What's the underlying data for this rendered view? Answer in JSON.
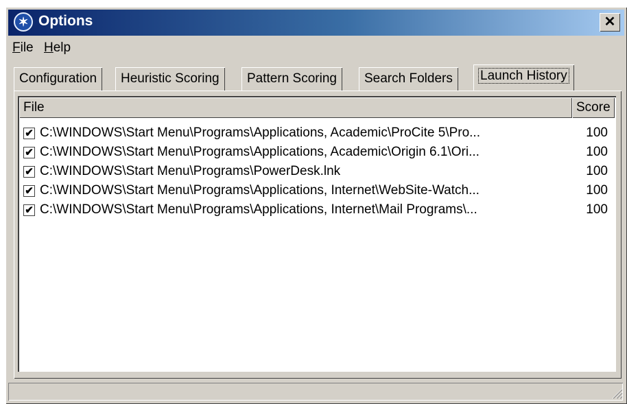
{
  "window": {
    "title": "Options",
    "close_glyph": "✕"
  },
  "menu": [
    {
      "label": "File",
      "accel": "F",
      "rest": "ile"
    },
    {
      "label": "Help",
      "accel": "H",
      "rest": "elp"
    }
  ],
  "tabs": [
    {
      "label": "Configuration"
    },
    {
      "label": "Heuristic Scoring"
    },
    {
      "label": "Pattern Scoring"
    },
    {
      "label": "Search Folders"
    },
    {
      "label": "Launch History",
      "active": true
    }
  ],
  "list": {
    "columns": {
      "file": "File",
      "score": "Score"
    },
    "rows": [
      {
        "checked": true,
        "file": "C:\\WINDOWS\\Start Menu\\Programs\\Applications, Academic\\ProCite 5\\Pro...",
        "score": "100"
      },
      {
        "checked": true,
        "file": "C:\\WINDOWS\\Start Menu\\Programs\\Applications, Academic\\Origin 6.1\\Ori...",
        "score": "100"
      },
      {
        "checked": true,
        "file": "C:\\WINDOWS\\Start Menu\\Programs\\PowerDesk.lnk",
        "score": "100"
      },
      {
        "checked": true,
        "file": "C:\\WINDOWS\\Start Menu\\Programs\\Applications, Internet\\WebSite-Watch...",
        "score": "100"
      },
      {
        "checked": true,
        "file": "C:\\WINDOWS\\Start Menu\\Programs\\Applications, Internet\\Mail Programs\\...",
        "score": "100"
      }
    ]
  },
  "icons": {
    "app": "app-runner-icon",
    "check": "✔"
  },
  "colors": {
    "titlebar_start": "#0a246a",
    "titlebar_end": "#a6caf0",
    "face": "#d4d0c8"
  }
}
